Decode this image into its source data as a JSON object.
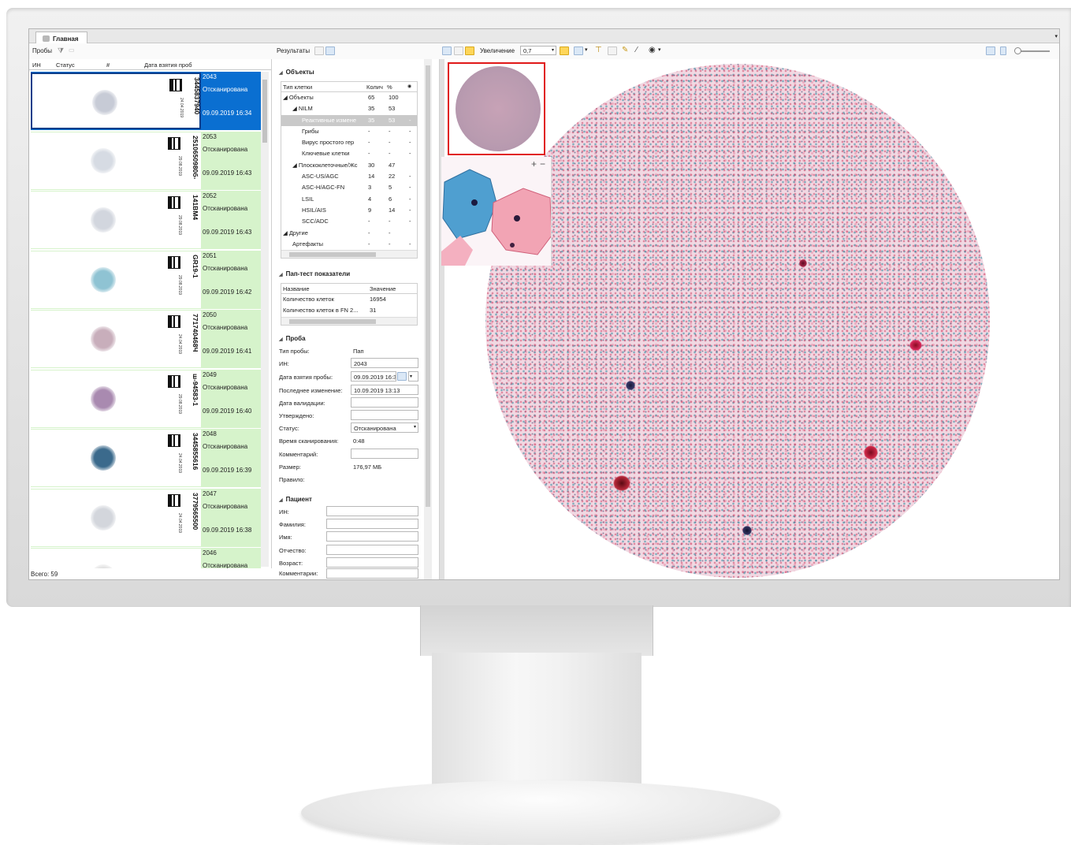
{
  "app": {
    "tab_label": "Главная"
  },
  "toolbar": {
    "samples_label": "Пробы",
    "results_label": "Результаты",
    "zoom_label": "Увеличение",
    "zoom_value": "0,7"
  },
  "list": {
    "columns": [
      "ИН",
      "Статус",
      "#",
      "Дата взятия проб"
    ],
    "rows": [
      {
        "num": "2043",
        "barcode": "3445837940",
        "status": "Отсканирована",
        "date": "09.09.2019 16:34",
        "small": "24.04.2019",
        "tint": "#c7cbd6"
      },
      {
        "num": "2053",
        "barcode": "2510650980б-",
        "status": "Отсканирована",
        "date": "09.09.2019 16:43",
        "small": "29.08.2019",
        "tint": "#d6dbe3"
      },
      {
        "num": "2052",
        "barcode": "141BM4",
        "status": "Отсканирована",
        "date": "09.09.2019 16:43",
        "small": "29.08.2019",
        "tint": "#d2d6de"
      },
      {
        "num": "2051",
        "barcode": "GR19-1",
        "status": "Отсканирована",
        "date": "09.09.2019 16:42",
        "small": "29.08.2019",
        "tint": "#8fc3d3"
      },
      {
        "num": "2050",
        "barcode": "771740468Ч",
        "status": "Отсканирована",
        "date": "09.09.2019 16:41",
        "small": "24.04.2019",
        "tint": "#c8aebb"
      },
      {
        "num": "2049",
        "barcode": "ш-94583-1",
        "status": "Отсканирована",
        "date": "09.09.2019 16:40",
        "small": "29.08.2019",
        "tint": "#a98ab0"
      },
      {
        "num": "2048",
        "barcode": "3445855616",
        "status": "Отсканирована",
        "date": "09.09.2019 16:39",
        "small": "24.04.2019",
        "tint": "#3b6a8c"
      },
      {
        "num": "2047",
        "barcode": "3779565500",
        "status": "Отсканирована",
        "date": "09.09.2019 16:38",
        "small": "24.04.2019",
        "tint": "#d3d6dc"
      },
      {
        "num": "2046",
        "barcode": "",
        "status": "Отсканирована",
        "date": "",
        "small": "",
        "tint": "#e0e0e0"
      }
    ],
    "total_label": "Всего: 59"
  },
  "objects": {
    "title": "Объекты",
    "headers": [
      "Тип клетки",
      "Колич",
      "%"
    ],
    "rows": [
      {
        "name": "◢ Объекты",
        "count": "65",
        "pct": "100",
        "extra": "",
        "indent": 0
      },
      {
        "name": "◢ NILM",
        "count": "35",
        "pct": "53",
        "extra": "",
        "indent": 1
      },
      {
        "name": "Реактивные измене",
        "count": "35",
        "pct": "53",
        "extra": "-",
        "indent": 2
      },
      {
        "name": "Грибы",
        "count": "-",
        "pct": "-",
        "extra": "-",
        "indent": 2
      },
      {
        "name": "Вирус простого гер",
        "count": "-",
        "pct": "-",
        "extra": "-",
        "indent": 2
      },
      {
        "name": "Ключевые клетки",
        "count": "-",
        "pct": "-",
        "extra": "-",
        "indent": 2
      },
      {
        "name": "◢ Плоскоклеточные/Жс",
        "count": "30",
        "pct": "47",
        "extra": "",
        "indent": 1
      },
      {
        "name": "ASC-US/AGC",
        "count": "14",
        "pct": "22",
        "extra": "-",
        "indent": 2
      },
      {
        "name": "ASC-H/AGC-FN",
        "count": "3",
        "pct": "5",
        "extra": "-",
        "indent": 2
      },
      {
        "name": "LSIL",
        "count": "4",
        "pct": "6",
        "extra": "-",
        "indent": 2
      },
      {
        "name": "HSIL/AIS",
        "count": "9",
        "pct": "14",
        "extra": "-",
        "indent": 2
      },
      {
        "name": "SCC/ADC",
        "count": "-",
        "pct": "-",
        "extra": "-",
        "indent": 2
      },
      {
        "name": "◢ Другие",
        "count": "-",
        "pct": "-",
        "extra": "",
        "indent": 0
      },
      {
        "name": "Артефакты",
        "count": "-",
        "pct": "-",
        "extra": "-",
        "indent": 1
      }
    ]
  },
  "pap": {
    "title": "Пап-тест показатели",
    "headers": [
      "Название",
      "Значение"
    ],
    "rows": [
      {
        "name": "Количество клеток",
        "value": "16954"
      },
      {
        "name": "Количество клеток в FN 2...",
        "value": "31"
      }
    ]
  },
  "sample": {
    "title": "Проба",
    "type_label": "Тип пробы:",
    "type_value": "Пап",
    "id_label": "ИН:",
    "id_value": "2043",
    "taken_label": "Дата взятия пробы:",
    "taken_value": "09.09.2019 16:3",
    "modified_label": "Последнее изменение:",
    "modified_value": "10.09.2019 13:13",
    "validated_label": "Дата валидации:",
    "approved_label": "Утверждено:",
    "status_label": "Статус:",
    "status_value": "Отсканирована",
    "scan_time_label": "Время сканирования:",
    "scan_time_value": "0:48",
    "comment_label": "Комментарий:",
    "size_label": "Размер:",
    "size_value": "176,97 МБ",
    "rule_label": "Правило:"
  },
  "patient": {
    "title": "Пациент",
    "id_label": "ИН:",
    "last_name_label": "Фамилия:",
    "first_name_label": "Имя:",
    "middle_name_label": "Отчество:",
    "age_label": "Возраст:",
    "comment_label": "Комментарии:"
  }
}
